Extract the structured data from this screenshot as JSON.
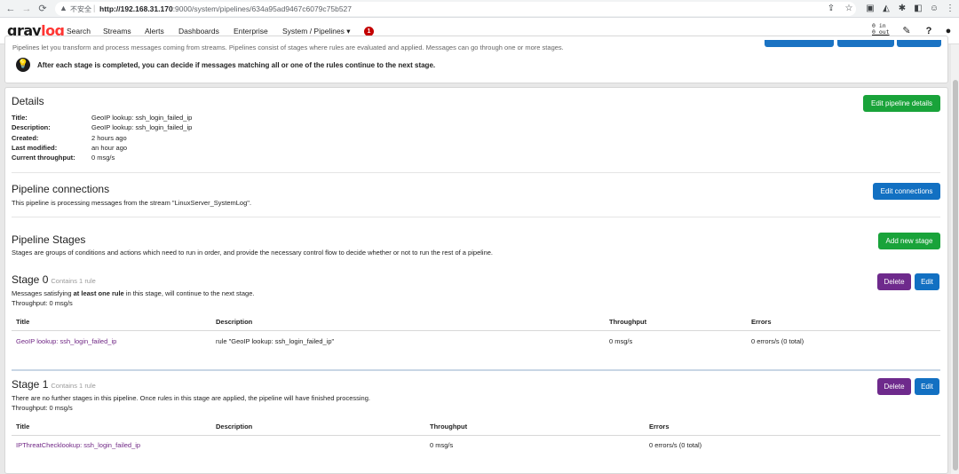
{
  "browser": {
    "insecure_label": "不安全",
    "url_host": "http://192.168.31.170",
    "url_rest": ":9000/system/pipelines/634a95ad9467c6079c75b527"
  },
  "nav": {
    "logo_gray": "gray",
    "logo_log": "log",
    "items": [
      "Search",
      "Streams",
      "Alerts",
      "Dashboards",
      "Enterprise",
      "System / Pipelines ▾"
    ],
    "alert_count": "1",
    "throughput_in": "0 in",
    "throughput_out": "0 out"
  },
  "info": {
    "description": "Pipelines let you transform and process messages coming from streams. Pipelines consist of stages where rules are evaluated and applied. Messages can go through one or more stages.",
    "tip": "After each stage is completed, you can decide if messages matching all or one of the rules continue to the next stage."
  },
  "details": {
    "heading": "Details",
    "edit_button": "Edit pipeline details",
    "title_label": "Title:",
    "title_value": "GeoIP lookup: ssh_login_failed_ip",
    "description_label": "Description:",
    "description_value": "GeoIP lookup: ssh_login_failed_ip",
    "created_label": "Created:",
    "created_value": "2 hours ago",
    "modified_label": "Last modified:",
    "modified_value": "an hour ago",
    "throughput_label": "Current throughput:",
    "throughput_value": "0 msg/s"
  },
  "connections": {
    "heading": "Pipeline connections",
    "text": "This pipeline is processing messages from the stream \"LinuxServer_SystemLog\".",
    "edit_button": "Edit connections"
  },
  "stages": {
    "heading": "Pipeline Stages",
    "text": "Stages are groups of conditions and actions which need to run in order, and provide the necessary control flow to decide whether or not to run the rest of a pipeline.",
    "add_button": "Add new stage",
    "delete_label": "Delete",
    "edit_label": "Edit",
    "col_title": "Title",
    "col_description": "Description",
    "col_throughput": "Throughput",
    "col_errors": "Errors",
    "stage0": {
      "title": "Stage 0",
      "subtitle": "Contains 1 rule",
      "msg_before": "Messages satisfying ",
      "msg_bold": "at least one rule",
      "msg_after": " in this stage, will continue to the next stage.",
      "throughput": "Throughput: 0 msg/s",
      "rule_title": "GeoIP lookup: ssh_login_failed_ip",
      "rule_description": "rule \"GeoIP lookup: ssh_login_failed_ip\"",
      "rule_throughput": "0 msg/s",
      "rule_errors": "0 errors/s (0 total)"
    },
    "stage1": {
      "title": "Stage 1",
      "subtitle": "Contains 1 rule",
      "msg": "There are no further stages in this pipeline. Once rules in this stage are applied, the pipeline will have finished processing.",
      "throughput": "Throughput: 0 msg/s",
      "rule_title": "IPThreatChecklookup: ssh_login_failed_ip",
      "rule_description": "",
      "rule_throughput": "0 msg/s",
      "rule_errors": "0 errors/s (0 total)"
    }
  }
}
